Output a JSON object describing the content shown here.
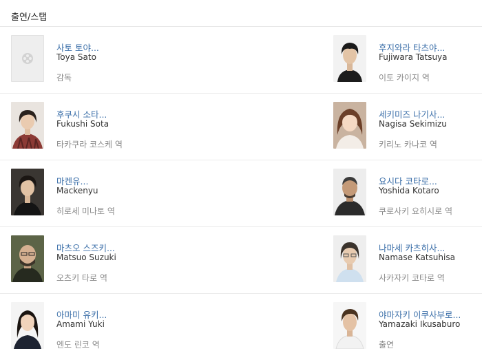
{
  "section": {
    "title": "출연/스탭"
  },
  "cast": [
    {
      "name_ko": "사토 토야...",
      "name_en": "Toya Sato",
      "role": "감독",
      "photo": "placeholder-film-icon"
    },
    {
      "name_ko": "후지와라 타츠야...",
      "name_en": "Fujiwara Tatsuya",
      "role": "이토 카이지 역",
      "photo": "portrait"
    },
    {
      "name_ko": "후쿠시 소타...",
      "name_en": "Fukushi Sota",
      "role": "타카쿠라 코스케 역",
      "photo": "portrait"
    },
    {
      "name_ko": "세키미즈 나기사...",
      "name_en": "Nagisa Sekimizu",
      "role": "키리노 카나코 역",
      "photo": "portrait"
    },
    {
      "name_ko": "마켄유...",
      "name_en": "Mackenyu",
      "role": "히로세 미나토 역",
      "photo": "portrait"
    },
    {
      "name_ko": "요시다 코타로...",
      "name_en": "Yoshida Kotaro",
      "role": "쿠로사키 요히시로 역",
      "photo": "portrait"
    },
    {
      "name_ko": "마츠오 스즈키...",
      "name_en": "Matsuo Suzuki",
      "role": "오츠키 타로 역",
      "photo": "portrait"
    },
    {
      "name_ko": "나마세 카츠히사...",
      "name_en": "Namase Katsuhisa",
      "role": "사카자키 코타로 역",
      "photo": "portrait"
    },
    {
      "name_ko": "아마미 유키...",
      "name_en": "Amami Yuki",
      "role": "엔도 린코 역",
      "photo": "portrait"
    },
    {
      "name_ko": "야마자키 이쿠사부로...",
      "name_en": "Yamazaki Ikusaburo",
      "role": "출연",
      "photo": "portrait"
    }
  ]
}
